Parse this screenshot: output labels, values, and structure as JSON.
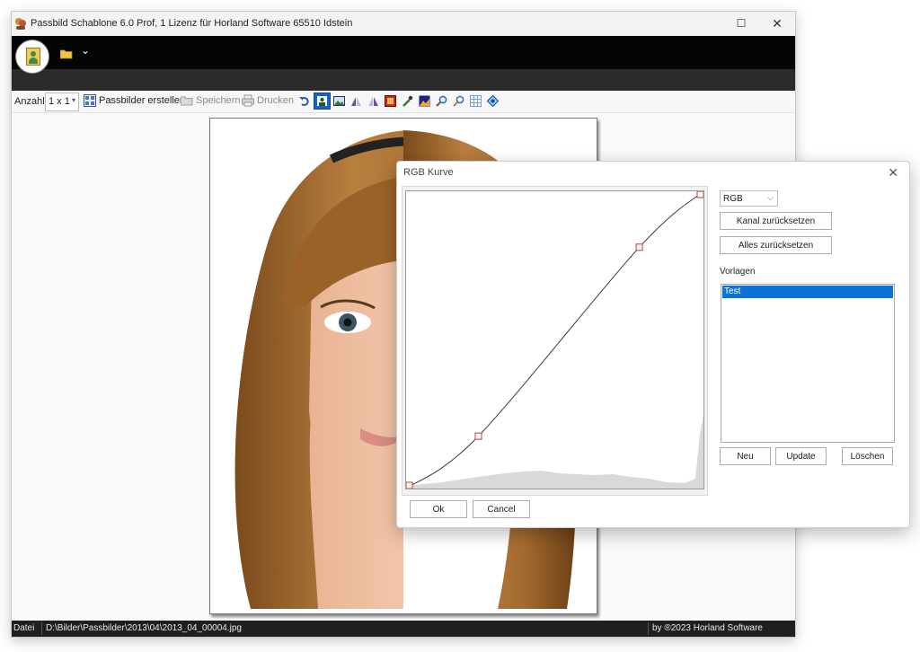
{
  "window": {
    "title": "Passbild Schablone 6.0 Prof, 1 Lizenz für Horland Software 65510 Idstein",
    "minimize_glyph": "☐",
    "close_glyph": "✕"
  },
  "ribbon": {
    "folder_glyph": "📂",
    "dropdown_glyph": "⌄"
  },
  "toolbar": {
    "anzahl_label": "Anzahl",
    "anzahl_value": "1 x 1",
    "anzahl_caret": "▾",
    "create_label": "Passbilder erstellen",
    "save_label": "Speichern",
    "print_label": "Drucken",
    "tools": [
      "undo-icon",
      "select-portrait-icon",
      "image-icon",
      "flip-horizontal-icon",
      "flip-vertical-icon",
      "color-adjust-icon",
      "pipette-icon",
      "image-tone-icon",
      "zoom-out-icon",
      "zoom-in-icon",
      "grid-icon",
      "rotate-diamond-icon"
    ]
  },
  "statusbar": {
    "left_label": "Datei",
    "path": "D:\\Bilder\\Passbilder\\2013\\04\\2013_04_00004.jpg",
    "credit": "by ®2023 Horland Software"
  },
  "dialog": {
    "title": "RGB Kurve",
    "close_glyph": "✕",
    "channel_select": "RGB",
    "channel_caret": "⌵",
    "reset_channel": "Kanal zurücksetzen",
    "reset_all": "Alles zurücksetzen",
    "templates_label": "Vorlagen",
    "templates": [
      "Test"
    ],
    "new_label": "Neu",
    "update_label": "Update",
    "delete_label": "Löschen",
    "ok_label": "Ok",
    "cancel_label": "Cancel",
    "curve_points": [
      [
        0,
        0
      ],
      [
        62,
        45
      ],
      [
        200,
        207
      ],
      [
        255,
        255
      ]
    ],
    "colors": {
      "curve_line": "#3a3a3a",
      "control_point": "#c0392b",
      "histogram": "#d9d9d9",
      "selection": "#0a74d6"
    }
  }
}
